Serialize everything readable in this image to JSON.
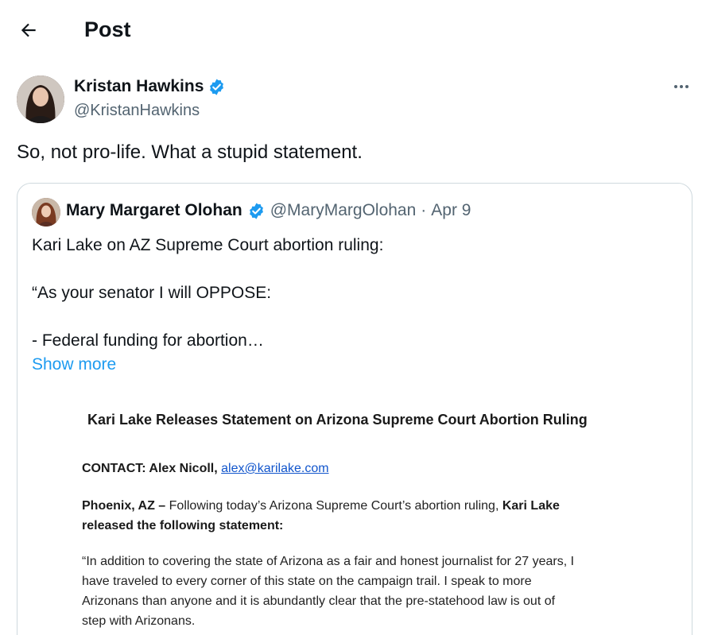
{
  "header": {
    "title": "Post",
    "back_icon": "arrow-left-icon"
  },
  "post": {
    "author_name": "Kristan Hawkins",
    "author_handle": "@KristanHawkins",
    "verified": true,
    "text": "So, not pro-life. What a stupid statement.",
    "more_icon": "more-horizontal-icon"
  },
  "quoted_post": {
    "author_name": "Mary Margaret Olohan",
    "author_handle": "@MaryMargOlohan",
    "separator": "·",
    "date": "Apr 9",
    "verified": true,
    "lines": [
      "Kari Lake on AZ Supreme Court abortion ruling:",
      "“As your senator I will OPPOSE:",
      "- Federal funding for abortion…"
    ],
    "show_more_label": "Show more",
    "image": {
      "title": "Kari Lake Releases Statement on Arizona Supreme Court Abortion Ruling",
      "contact_label": "CONTACT: Alex Nicoll,",
      "contact_email": "alex@karilake.com",
      "p1_location": "Phoenix, AZ –",
      "p1_text": " Following today’s Arizona Supreme Court’s abortion ruling, ",
      "p1_name": "Kari Lake",
      "p1_line2": "released the following statement:",
      "p2_lines": [
        "“In addition to covering the state of Arizona as a fair and honest journalist for 27 years, I",
        "have traveled to every corner of this state on the campaign trail. I speak to more",
        "Arizonans than anyone and it is abundantly clear that the pre-statehood law is out of",
        "step with Arizonans."
      ]
    }
  },
  "colors": {
    "text_primary": "#0f1419",
    "text_secondary": "#536471",
    "link": "#1d9bf0",
    "verified_badge": "#1d9bf0",
    "border": "#cfd9de"
  }
}
